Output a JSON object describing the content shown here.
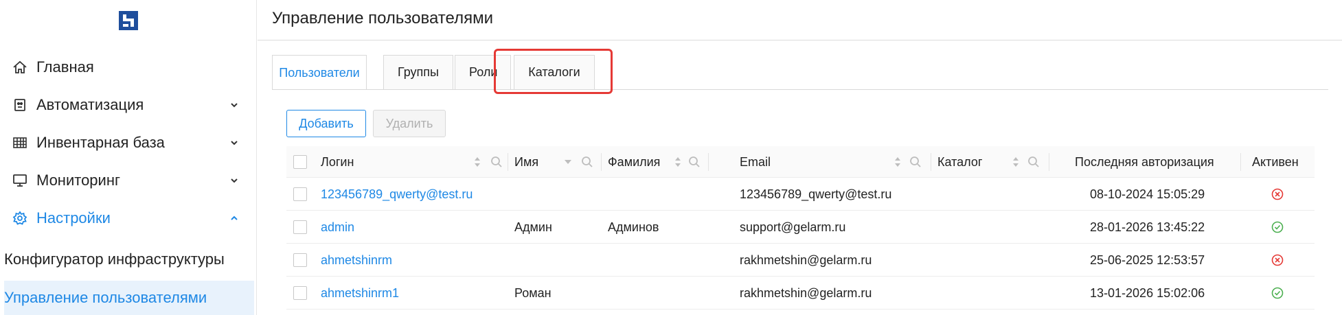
{
  "sidebar": {
    "items": [
      {
        "label": "Главная",
        "icon": "home-icon"
      },
      {
        "label": "Автоматизация",
        "icon": "robot-icon"
      },
      {
        "label": "Инвентарная база",
        "icon": "table-icon"
      },
      {
        "label": "Мониторинг",
        "icon": "monitor-icon"
      },
      {
        "label": "Настройки",
        "icon": "gear-icon"
      }
    ],
    "sub_items": [
      {
        "label": "Конфигуратор инфраструктуры"
      },
      {
        "label": "Управление пользователями"
      }
    ]
  },
  "header": {
    "title": "Управление пользователями"
  },
  "tabs": [
    {
      "label": "Пользователи"
    },
    {
      "label": "Группы"
    },
    {
      "label": "Роли"
    },
    {
      "label": "Каталоги"
    }
  ],
  "toolbar": {
    "add_label": "Добавить",
    "delete_label": "Удалить"
  },
  "table": {
    "columns": [
      "Логин",
      "Имя",
      "Фамилия",
      "Email",
      "Каталог",
      "Последняя авторизация",
      "Активен"
    ],
    "rows": [
      {
        "login": "123456789_qwerty@test.ru",
        "first_name": "",
        "last_name": "",
        "email": "123456789_qwerty@test.ru",
        "catalog": "",
        "last_auth": "08-10-2024 15:05:29",
        "active": false
      },
      {
        "login": "admin",
        "first_name": "Админ",
        "last_name": "Админов",
        "email": "support@gelarm.ru",
        "catalog": "",
        "last_auth": "28-01-2026 13:45:22",
        "active": true
      },
      {
        "login": "ahmetshinrm",
        "first_name": "",
        "last_name": "",
        "email": "rakhmetshin@gelarm.ru",
        "catalog": "",
        "last_auth": "25-06-2025 12:53:57",
        "active": false
      },
      {
        "login": "ahmetshinrm1",
        "first_name": "Роман",
        "last_name": "",
        "email": "rakhmetshin@gelarm.ru",
        "catalog": "",
        "last_auth": "13-01-2026 15:02:06",
        "active": true
      }
    ]
  },
  "colors": {
    "accent": "#1e88e5",
    "active": "#4caf50",
    "inactive": "#e53935",
    "highlight": "#e53935",
    "logo": "#1f4e9c"
  }
}
